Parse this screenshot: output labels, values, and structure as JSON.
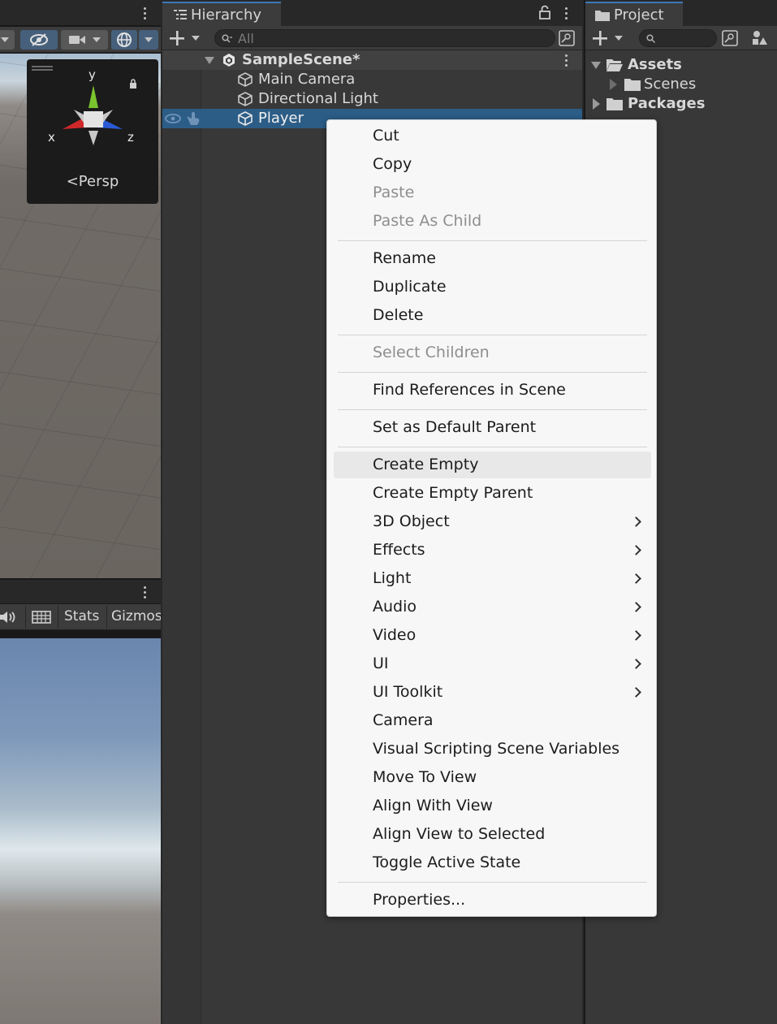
{
  "scene_view": {
    "gizmo": {
      "axis_x": "x",
      "axis_y": "y",
      "axis_z": "z",
      "projection": "Persp"
    }
  },
  "game_view": {
    "toolbar": {
      "stats_label": "Stats",
      "gizmos_label": "Gizmos"
    }
  },
  "hierarchy": {
    "tab_label": "Hierarchy",
    "search_placeholder": "All",
    "scene_name": "SampleScene*",
    "items": [
      "Main Camera",
      "Directional Light",
      "Player"
    ],
    "selected_item": "Player"
  },
  "project": {
    "tab_label": "Project",
    "tree": [
      {
        "label": "Assets",
        "expanded": true
      },
      {
        "label": "Scenes",
        "expanded": false
      },
      {
        "label": "Packages",
        "expanded": false
      }
    ]
  },
  "context_menu": {
    "items": [
      {
        "label": "Cut",
        "enabled": true
      },
      {
        "label": "Copy",
        "enabled": true
      },
      {
        "label": "Paste",
        "enabled": false
      },
      {
        "label": "Paste As Child",
        "enabled": false
      },
      {
        "label": "Rename",
        "enabled": true
      },
      {
        "label": "Duplicate",
        "enabled": true
      },
      {
        "label": "Delete",
        "enabled": true
      },
      {
        "label": "Select Children",
        "enabled": false
      },
      {
        "label": "Find References in Scene",
        "enabled": true
      },
      {
        "label": "Set as Default Parent",
        "enabled": true
      },
      {
        "label": "Create Empty",
        "enabled": true,
        "hovered": true
      },
      {
        "label": "Create Empty Parent",
        "enabled": true
      },
      {
        "label": "3D Object",
        "enabled": true,
        "submenu": true
      },
      {
        "label": "Effects",
        "enabled": true,
        "submenu": true
      },
      {
        "label": "Light",
        "enabled": true,
        "submenu": true
      },
      {
        "label": "Audio",
        "enabled": true,
        "submenu": true
      },
      {
        "label": "Video",
        "enabled": true,
        "submenu": true
      },
      {
        "label": "UI",
        "enabled": true,
        "submenu": true
      },
      {
        "label": "UI Toolkit",
        "enabled": true,
        "submenu": true
      },
      {
        "label": "Camera",
        "enabled": true
      },
      {
        "label": "Visual Scripting Scene Variables",
        "enabled": true
      },
      {
        "label": "Move To View",
        "enabled": true
      },
      {
        "label": "Align With View",
        "enabled": true
      },
      {
        "label": "Align View to Selected",
        "enabled": true
      },
      {
        "label": "Toggle Active State",
        "enabled": true
      },
      {
        "label": "Properties...",
        "enabled": true
      }
    ]
  },
  "colors": {
    "selection": "#2c5d87",
    "tab_accent": "#3a79bb",
    "menu_background": "#f7f7f7",
    "axis_x": "#d0282a",
    "axis_y": "#7ac52d",
    "axis_z": "#2a5bd6"
  },
  "icons": {
    "scene": "unity-scene-icon",
    "gameobject": "cube-icon",
    "folder": "folder-icon",
    "visibility": "eye-icon",
    "pickable": "hand-icon",
    "menu": "kebab-icon",
    "lock": "lock-icon",
    "search": "search-icon",
    "add": "plus-icon"
  }
}
